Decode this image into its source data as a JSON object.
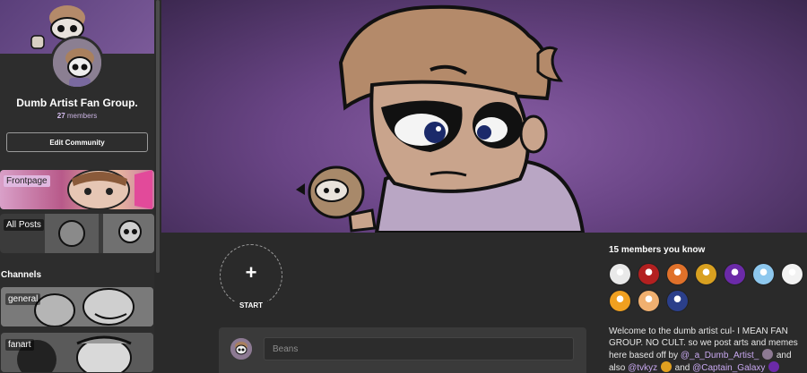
{
  "community": {
    "name": "Dumb Artist Fan Group.",
    "member_count": "27",
    "members_word": "members",
    "edit_label": "Edit Community"
  },
  "feeds": [
    {
      "label": "Frontpage"
    },
    {
      "label": "All Posts"
    }
  ],
  "channels_heading": "Channels",
  "channels": [
    {
      "label": "general"
    },
    {
      "label": "fanart"
    }
  ],
  "composer": {
    "start_label": "START",
    "start_plus": "+",
    "placeholder": "Beans"
  },
  "members_you_know": {
    "heading": "15 members you know",
    "avatars": [
      {
        "name": "avatar-sketch-white",
        "color": "#e9e9e9"
      },
      {
        "name": "avatar-red-black",
        "color": "#b32020"
      },
      {
        "name": "avatar-orange-blue",
        "color": "#e0712a"
      },
      {
        "name": "avatar-yellow-pixel",
        "color": "#d8a020"
      },
      {
        "name": "avatar-purple-orb",
        "color": "#6b2aa8"
      },
      {
        "name": "avatar-light-blue",
        "color": "#8ec8ee"
      },
      {
        "name": "avatar-sketch-white-2",
        "color": "#f2f2f2"
      },
      {
        "name": "avatar-orange-gold",
        "color": "#f0a020"
      },
      {
        "name": "avatar-cake",
        "color": "#f0b070"
      },
      {
        "name": "avatar-dark-blue",
        "color": "#2b3f8a"
      }
    ]
  },
  "description": {
    "text_1": "Welcome to the dumb artist cul- I MEAN FAN GROUP. NO CULT. so we post arts and memes here based off by",
    "mention_1": "@_a_Dumb_Artist_",
    "text_2": "and also",
    "mention_2": "@tvkyz",
    "text_3": "and",
    "mention_3": "@Captain_Galaxy"
  },
  "colors": {
    "accent": "#c8a8f0",
    "background": "#2a2a2a",
    "sidebar": "#2d2d2d"
  }
}
